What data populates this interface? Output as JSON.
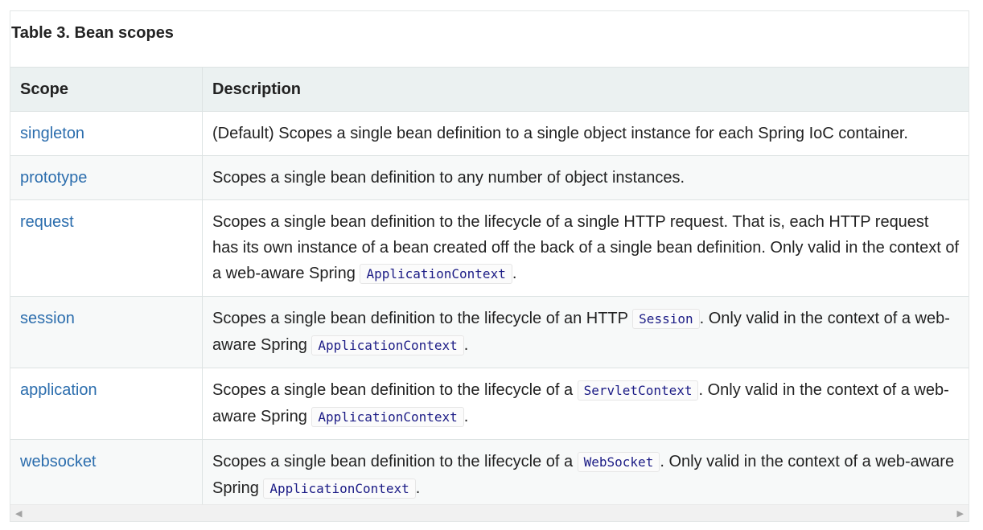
{
  "caption": "Table 3. Bean scopes",
  "headers": {
    "scope": "Scope",
    "description": "Description"
  },
  "rows": [
    {
      "scope": "singleton",
      "parts": [
        "(Default) Scopes a single bean definition to a single object instance for each Spring IoC container."
      ]
    },
    {
      "scope": "prototype",
      "parts": [
        "Scopes a single bean definition to any number of object instances."
      ]
    },
    {
      "scope": "request",
      "parts": [
        "Scopes a single bean definition to the lifecycle of a single HTTP request. That is, each HTTP request has its own instance of a bean created off the back of a single bean definition. Only valid in the context of a web-aware Spring ",
        "ApplicationContext",
        "."
      ]
    },
    {
      "scope": "session",
      "parts": [
        "Scopes a single bean definition to the lifecycle of an HTTP ",
        "Session",
        ". Only valid in the context of a web-aware Spring ",
        "ApplicationContext",
        "."
      ]
    },
    {
      "scope": "application",
      "parts": [
        "Scopes a single bean definition to the lifecycle of a ",
        "ServletContext",
        ". Only valid in the context of a web-aware Spring ",
        "ApplicationContext",
        "."
      ]
    },
    {
      "scope": "websocket",
      "parts": [
        "Scopes a single bean definition to the lifecycle of a ",
        "WebSocket",
        ". Only valid in the context of a web-aware Spring ",
        "ApplicationContext",
        "."
      ]
    }
  ],
  "scrollbar": {
    "left_icon": "triangle-left-icon",
    "right_icon": "triangle-right-icon"
  },
  "colors": {
    "link": "#2b6dad",
    "code": "#1b1b85",
    "header_bg": "#ebf1f1",
    "stripe_bg": "#f7f9f9"
  }
}
